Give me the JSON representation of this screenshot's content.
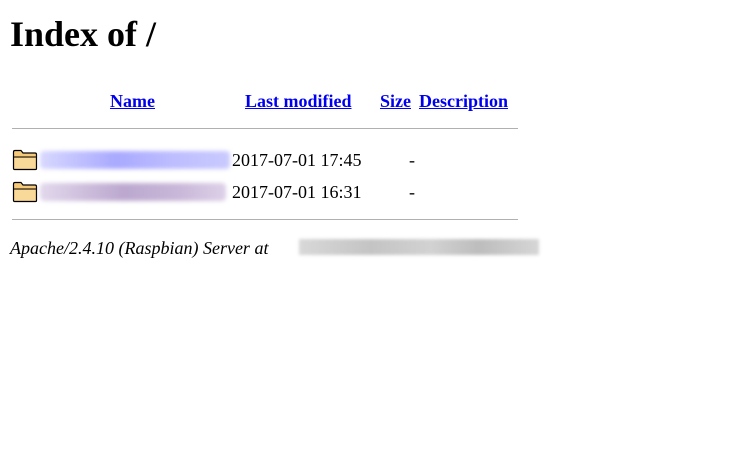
{
  "page": {
    "title": "Index of /"
  },
  "table": {
    "headers": {
      "name": "Name",
      "last_modified": "Last modified",
      "size": "Size",
      "description": "Description"
    },
    "rows": [
      {
        "icon": "folder-icon",
        "name": "",
        "last_modified": "2017-07-01 17:45",
        "size": "-",
        "description": ""
      },
      {
        "icon": "folder-icon",
        "name": "",
        "last_modified": "2017-07-01 16:31",
        "size": "-",
        "description": ""
      }
    ]
  },
  "footer": {
    "text": "Apache/2.4.10 (Raspbian) Server at"
  },
  "colors": {
    "link": "#0000ee",
    "rule": "#b0b0b0",
    "folder_fill": "#f5c97a",
    "folder_stroke": "#000000"
  }
}
